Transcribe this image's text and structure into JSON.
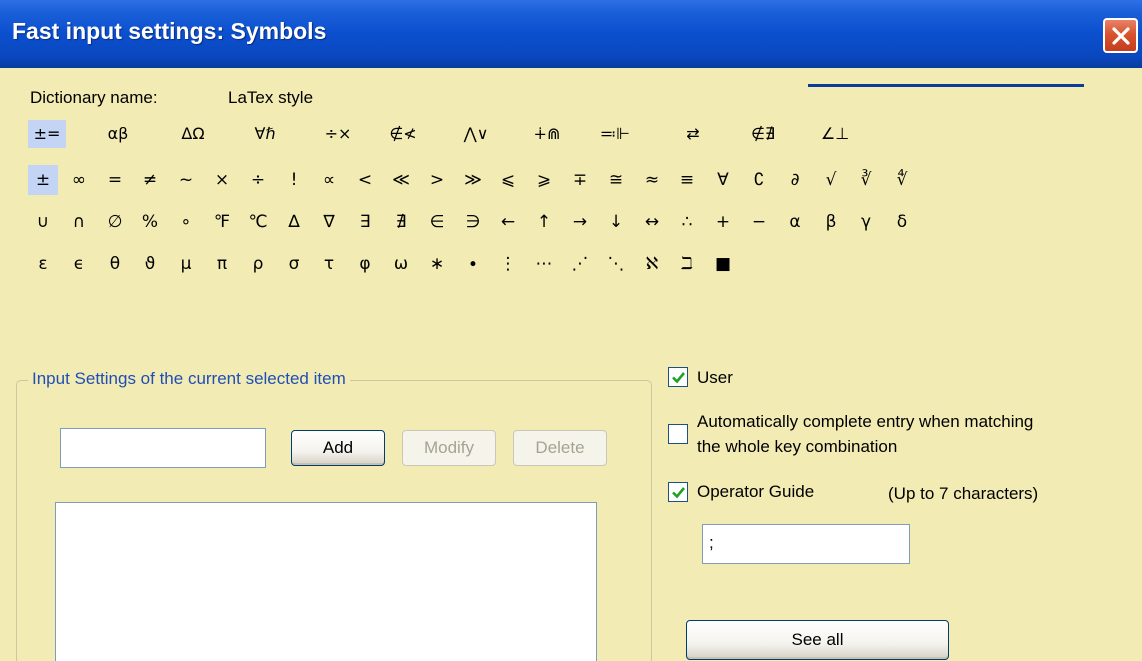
{
  "window": {
    "title": "Fast input settings: Symbols",
    "close_glyph": "✕"
  },
  "dictionary": {
    "label": "Dictionary name:",
    "value": "LaTex style"
  },
  "categories": [
    "±=",
    "αβ",
    "ΔΩ",
    "∀ℏ",
    "÷×",
    "∉≮",
    "⋀∨",
    "∔⋒",
    "≕⊩",
    "⇄",
    "∉∄",
    "∠⊥"
  ],
  "selected_category_index": 0,
  "symbols": [
    [
      "±",
      "∞",
      "=",
      "≠",
      "~",
      "×",
      "÷",
      "!",
      "∝",
      "<",
      "≪",
      ">",
      "≫",
      "⩽",
      "⩾",
      "∓",
      "≅",
      "≈",
      "≡",
      "∀",
      "∁",
      "∂",
      "√",
      "∛",
      "∜"
    ],
    [
      "∪",
      "∩",
      "∅",
      "%",
      "∘",
      "℉",
      "℃",
      "∆",
      "∇",
      "∃",
      "∄",
      "∈",
      "∋",
      "←",
      "↑",
      "→",
      "↓",
      "↔",
      "∴",
      "+",
      "−",
      "α",
      "β",
      "γ",
      "δ"
    ],
    [
      "ε",
      "ϵ",
      "θ",
      "ϑ",
      "μ",
      "π",
      "ρ",
      "σ",
      "τ",
      "φ",
      "ω",
      "∗",
      "∙",
      "⋮",
      "⋯",
      "⋰",
      "⋱",
      "ℵ",
      "ℶ",
      "■"
    ]
  ],
  "selected_symbol": {
    "row": 0,
    "col": 0
  },
  "input_settings": {
    "group_label": "Input Settings of the current selected item",
    "key_value": "",
    "add_label": "Add",
    "modify_label": "Modify",
    "delete_label": "Delete",
    "list_items": []
  },
  "options": {
    "user": {
      "label": "User",
      "checked": true
    },
    "auto_complete": {
      "label_line1": "Automatically complete entry when matching",
      "label_line2": "the whole key combination",
      "checked": false
    },
    "operator_guide": {
      "label": "Operator Guide",
      "checked": true,
      "hint": "(Up to 7 characters)",
      "value": ";"
    }
  },
  "see_all_label": "See all",
  "colors": {
    "title_bar": "#0b4fcf",
    "panel_bg": "#f3ebb4",
    "selection": "#c3d4f5",
    "group_label": "#1f4fb6",
    "close_button": "#d9532f"
  }
}
